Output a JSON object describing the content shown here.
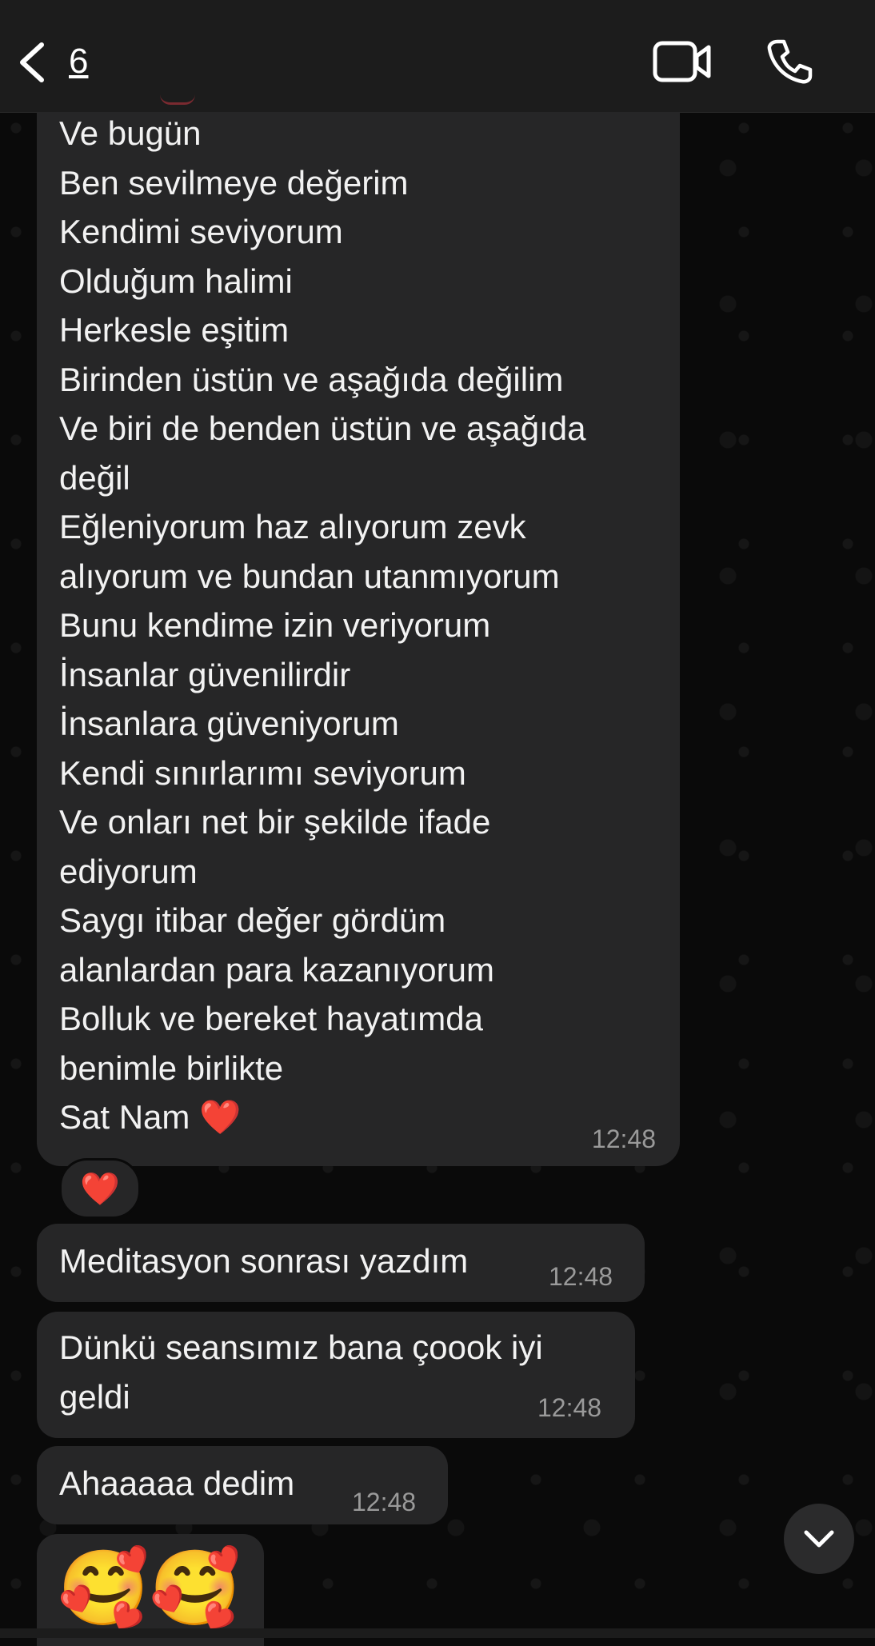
{
  "header": {
    "back_count": "6"
  },
  "icons": {
    "back": "chevron-left-icon",
    "video": "video-camera-icon",
    "phone": "phone-icon",
    "scroll_down": "chevron-down-icon",
    "heart": "red-heart-emoji",
    "smiling_hearts": "smiling-face-with-hearts-emoji"
  },
  "colors": {
    "header_bg": "#1c1c1c",
    "bubble_bg": "#262627",
    "heart_red": "#e0202c"
  },
  "messages": [
    {
      "lines": [
        "Ve bugün",
        "Ben sevilmeye değerim",
        "Kendimi seviyorum",
        "Olduğum halimi",
        "Herkesle eşitim",
        "Birinden üstün ve aşağıda değilim",
        "Ve biri de benden üstün ve aşağıda",
        "değil",
        "Eğleniyorum haz alıyorum zevk",
        "alıyorum ve bundan utanmıyorum",
        "Bunu kendime izin veriyorum",
        "İnsanlar güvenilirdir",
        "İnsanlara güveniyorum",
        "Kendi sınırlarımı seviyorum",
        "Ve onları net bir şekilde ifade",
        "ediyorum",
        "Saygı itibar değer gördüm",
        "alanlardan para kazanıyorum",
        "Bolluk ve bereket hayatımda",
        "benimle birlikte",
        "Sat Nam ❤️"
      ],
      "time": "12:48",
      "reaction": "❤️"
    },
    {
      "text": "Meditasyon sonrası yazdım",
      "time": "12:48"
    },
    {
      "text": "Dünkü seansımız bana çoook iyi\ngeldi",
      "time": "12:48"
    },
    {
      "text": "Ahaaaaa dedim",
      "time": "12:48"
    },
    {
      "emojis": "🥰🥰"
    }
  ]
}
